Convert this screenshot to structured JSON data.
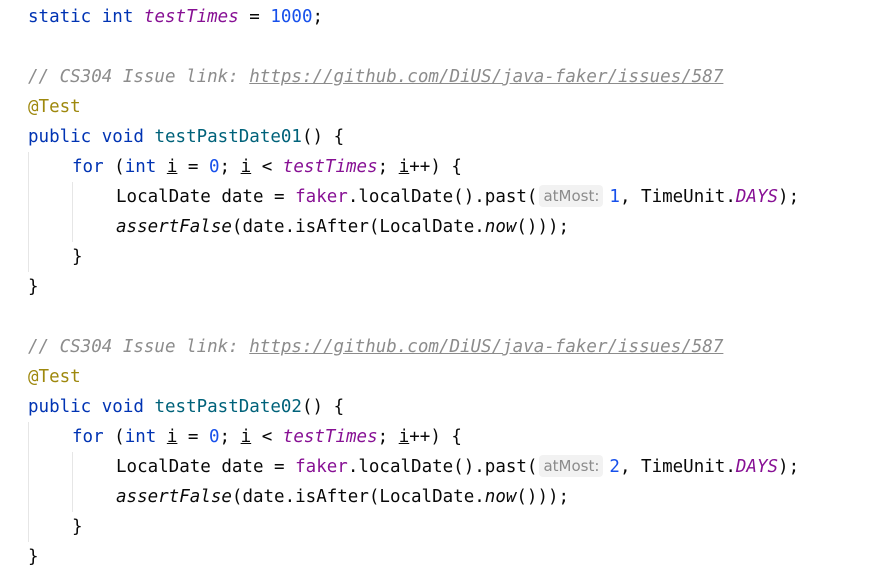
{
  "header": {
    "kw_static": "static",
    "kw_int": "int",
    "field_name": "testTimes",
    "op": " = ",
    "value": "1000",
    "semi": ";"
  },
  "blocks": [
    {
      "comment": "// CS304 Issue link: ",
      "link": "https://github.com/DiUS/java-faker/issues/587",
      "annotation": "@Test",
      "kw_public": "public",
      "kw_void": "void",
      "method_name": "testPastDate01",
      "sig_tail": "() {",
      "kw_for": "for",
      "for_open": " (",
      "kw_int": "int",
      "loop_var": "i",
      "for_init": " = ",
      "zero": "0",
      "for_semi1": "; ",
      "lt": " < ",
      "field": "testTimes",
      "for_semi2": "; ",
      "inc": "++",
      "for_close": ") {",
      "stmt1_pre": "LocalDate date = ",
      "faker": "faker",
      "stmt1_mid": ".localDate().past(",
      "hint": "atMost:",
      "amount": "1",
      "stmt1_comma": ", TimeUnit.",
      "days": "DAYS",
      "stmt1_end": ");",
      "assert_name": "assertFalse",
      "assert_mid": "(date.isAfter(LocalDate.",
      "now": "now",
      "assert_end": "()));",
      "close_for": "}",
      "close_method": "}"
    },
    {
      "comment": "// CS304 Issue link: ",
      "link": "https://github.com/DiUS/java-faker/issues/587",
      "annotation": "@Test",
      "kw_public": "public",
      "kw_void": "void",
      "method_name": "testPastDate02",
      "sig_tail": "() {",
      "kw_for": "for",
      "for_open": " (",
      "kw_int": "int",
      "loop_var": "i",
      "for_init": " = ",
      "zero": "0",
      "for_semi1": "; ",
      "lt": " < ",
      "field": "testTimes",
      "for_semi2": "; ",
      "inc": "++",
      "for_close": ") {",
      "stmt1_pre": "LocalDate date = ",
      "faker": "faker",
      "stmt1_mid": ".localDate().past(",
      "hint": "atMost:",
      "amount": "2",
      "stmt1_comma": ", TimeUnit.",
      "days": "DAYS",
      "stmt1_end": ");",
      "assert_name": "assertFalse",
      "assert_mid": "(date.isAfter(LocalDate.",
      "now": "now",
      "assert_end": "()));",
      "close_for": "}",
      "close_method": "}"
    }
  ],
  "colors": {
    "background": "#ffffff",
    "keyword": "#0033b3",
    "number": "#1750eb",
    "field": "#871094",
    "method": "#00627a",
    "comment": "#8c8c8c",
    "annotation": "#9e880d"
  }
}
